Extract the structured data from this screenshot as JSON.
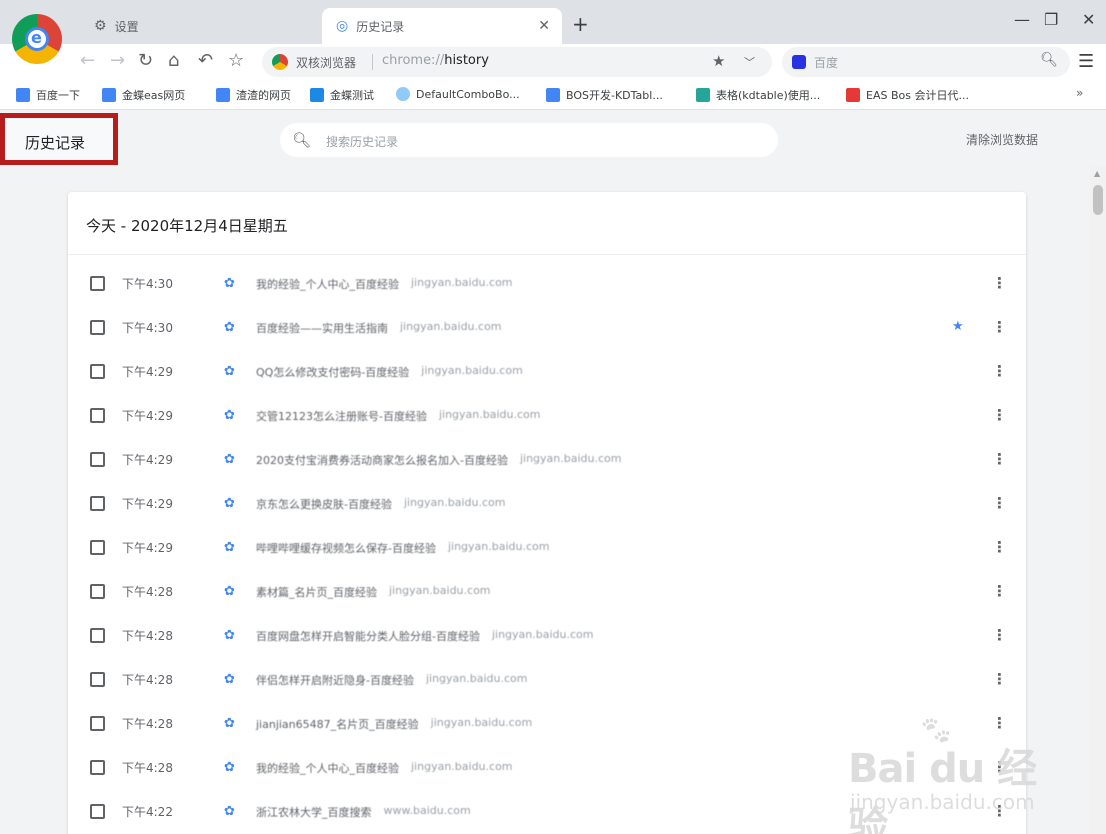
{
  "tabs": [
    {
      "label": "设置",
      "icon": "gear-icon",
      "active": false
    },
    {
      "label": "历史记录",
      "icon": "history-icon",
      "active": true
    }
  ],
  "omnibox": {
    "brand": "双核浏览器",
    "url_prefix": "chrome://",
    "url_path": "history"
  },
  "search_engine": {
    "placeholder": "百度"
  },
  "bookmarks": [
    {
      "label": "百度一下",
      "color": "#4285f4"
    },
    {
      "label": "金蝶eas网页",
      "color": "#4285f4"
    },
    {
      "label": "渣渣的网页",
      "color": "#4285f4"
    },
    {
      "label": "金蝶测试",
      "color": "#1e88e5"
    },
    {
      "label": "DefaultComboBo...",
      "color": "#64b5f6"
    },
    {
      "label": "BOS开发-KDTabl...",
      "color": "#4285f4"
    },
    {
      "label": "表格(kdtable)使用...",
      "color": "#26a69a"
    },
    {
      "label": "EAS Bos 会计日代...",
      "color": "#e53935"
    }
  ],
  "page": {
    "title": "历史记录",
    "search_placeholder": "搜索历史记录",
    "clear_label": "清除浏览数据"
  },
  "history": {
    "date_header": "今天 - 2020年12月4日星期五",
    "rows": [
      {
        "time": "下午4:30",
        "title": "我的经验_个人中心_百度经验",
        "domain": "jingyan.baidu.com",
        "starred": false
      },
      {
        "time": "下午4:30",
        "title": "百度经验——实用生活指南",
        "domain": "jingyan.baidu.com",
        "starred": true
      },
      {
        "time": "下午4:29",
        "title": "QQ怎么修改支付密码-百度经验",
        "domain": "jingyan.baidu.com",
        "starred": false
      },
      {
        "time": "下午4:29",
        "title": "交管12123怎么注册账号-百度经验",
        "domain": "jingyan.baidu.com",
        "starred": false
      },
      {
        "time": "下午4:29",
        "title": "2020支付宝消费券活动商家怎么报名加入-百度经验",
        "domain": "jingyan.baidu.com",
        "starred": false
      },
      {
        "time": "下午4:29",
        "title": "京东怎么更换皮肤-百度经验",
        "domain": "jingyan.baidu.com",
        "starred": false
      },
      {
        "time": "下午4:29",
        "title": "哔哩哔哩缓存视频怎么保存-百度经验",
        "domain": "jingyan.baidu.com",
        "starred": false
      },
      {
        "time": "下午4:28",
        "title": "素材篇_名片页_百度经验",
        "domain": "jingyan.baidu.com",
        "starred": false
      },
      {
        "time": "下午4:28",
        "title": "百度网盘怎样开启智能分类人脸分组-百度经验",
        "domain": "jingyan.baidu.com",
        "starred": false
      },
      {
        "time": "下午4:28",
        "title": "伴侣怎样开启附近隐身-百度经验",
        "domain": "jingyan.baidu.com",
        "starred": false
      },
      {
        "time": "下午4:28",
        "title": "jianjian65487_名片页_百度经验",
        "domain": "jingyan.baidu.com",
        "starred": false
      },
      {
        "time": "下午4:28",
        "title": "我的经验_个人中心_百度经验",
        "domain": "jingyan.baidu.com",
        "starred": false
      },
      {
        "time": "下午4:22",
        "title": "浙江农林大学_百度搜索",
        "domain": "www.baidu.com",
        "starred": false
      }
    ]
  },
  "watermark": {
    "brand": "Bai du 经验",
    "url": "jingyan.baidu.com"
  }
}
